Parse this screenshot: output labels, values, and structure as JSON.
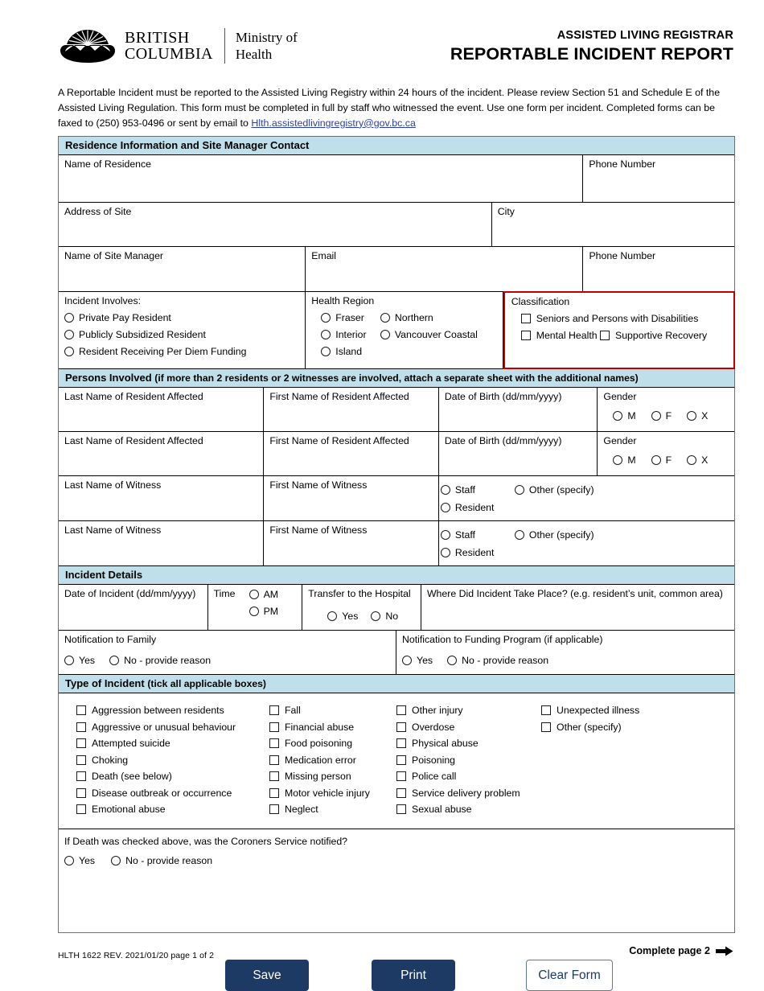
{
  "header": {
    "logo_line1": "BRITISH",
    "logo_line2": "COLUMBIA",
    "ministry_line1": "Ministry of",
    "ministry_line2": "Health",
    "registrar_title": "ASSISTED LIVING REGISTRAR",
    "form_title": "REPORTABLE INCIDENT REPORT"
  },
  "intro": {
    "text_before_link": "A Reportable Incident must be reported to the Assisted Living Registry within 24 hours of the incident. Please review Section 51 and Schedule E of the Assisted Living Regulation. This form must be completed in full by staff who witnessed the event. Use one form per incident. Completed forms can be faxed to (250) 953-0496 or sent by email to ",
    "email_link": "Hlth.assistedlivingregistry@gov.bc.ca"
  },
  "residence": {
    "section_title": "Residence Information and Site Manager Contact",
    "name_of_residence": "Name of Residence",
    "phone_number": "Phone Number",
    "address_of_site": "Address of Site",
    "city": "City",
    "name_of_site_manager": "Name of Site Manager",
    "email": "Email",
    "phone_number_2": "Phone Number",
    "incident_involves_label": "Incident Involves:",
    "incident_involves_options": [
      "Private Pay Resident",
      "Publicly Subsidized Resident",
      "Resident Receiving Per Diem Funding"
    ],
    "health_region_label": "Health Region",
    "health_region_options_col1": [
      "Fraser",
      "Interior",
      "Island"
    ],
    "health_region_options_col2": [
      "Northern",
      "Vancouver Coastal"
    ],
    "classification_label": "Classification",
    "classification_options": [
      "Seniors and Persons with Disabilities",
      "Mental Health",
      "Supportive Recovery"
    ]
  },
  "persons": {
    "section_title_bold": "Persons Involved ",
    "section_title_rest": "(if more than 2 residents or 2 witnesses are involved, attach a separate sheet with the additional names)",
    "resident_rows": [
      {
        "last_name": "Last Name of Resident Affected",
        "first_name": "First Name of Resident Affected",
        "dob": "Date of Birth (dd/mm/yyyy)",
        "gender_label": "Gender",
        "gender_options": [
          "M",
          "F",
          "X"
        ]
      },
      {
        "last_name": "Last Name of Resident Affected",
        "first_name": "First Name of Resident Affected",
        "dob": "Date of Birth (dd/mm/yyyy)",
        "gender_label": "Gender",
        "gender_options": [
          "M",
          "F",
          "X"
        ]
      }
    ],
    "witness_rows": [
      {
        "last_name": "Last Name of Witness",
        "first_name": "First Name of Witness",
        "type_options": [
          "Staff",
          "Other (specify)",
          "Resident"
        ]
      },
      {
        "last_name": "Last Name of Witness",
        "first_name": "First Name of Witness",
        "type_options": [
          "Staff",
          "Other (specify)",
          "Resident"
        ]
      }
    ]
  },
  "incident_details": {
    "section_title": "Incident Details",
    "date_label": "Date of Incident (dd/mm/yyyy)",
    "time_label": "Time",
    "time_options": [
      "AM",
      "PM"
    ],
    "transfer_label": "Transfer to the Hospital",
    "transfer_options": [
      "Yes",
      "No"
    ],
    "where_label": "Where Did Incident Take Place? (e.g. resident’s unit, common area)",
    "notify_family_label": "Notification to Family",
    "notify_family_options": [
      "Yes",
      "No - provide reason"
    ],
    "notify_funding_label": "Notification to Funding Program (if applicable)",
    "notify_funding_options": [
      "Yes",
      "No - provide reason"
    ]
  },
  "type_of_incident": {
    "section_title_bold": "Type of Incident ",
    "section_title_rest": "(tick all applicable boxes)",
    "columns": [
      [
        "Aggression between residents",
        "Aggressive or unusual behaviour",
        "Attempted suicide",
        "Choking",
        "Death (see below)",
        "Disease outbreak or occurrence",
        "Emotional abuse"
      ],
      [
        "Fall",
        "Financial abuse",
        "Food poisoning",
        "Medication error",
        "Missing person",
        "Motor vehicle injury",
        "Neglect"
      ],
      [
        "Other injury",
        "Overdose",
        "Physical abuse",
        "Poisoning",
        "Police call",
        "Service delivery problem",
        "Sexual abuse"
      ],
      [
        "Unexpected illness",
        "Other (specify)"
      ]
    ]
  },
  "coroner": {
    "question": "If Death was checked above, was the Coroners Service notified?",
    "options": [
      "Yes",
      "No - provide reason"
    ]
  },
  "footer": {
    "form_id": "HLTH 1622  REV.  2021/01/20   page 1 of 2",
    "complete_page_2": "Complete page 2",
    "save_label": "Save",
    "print_label": "Print",
    "clear_label": "Clear Form"
  },
  "colors": {
    "section_header_bg": "#bfe0ea",
    "classification_border": "#c00000",
    "button_primary": "#1c3a63",
    "link": "#2b3ea8"
  }
}
